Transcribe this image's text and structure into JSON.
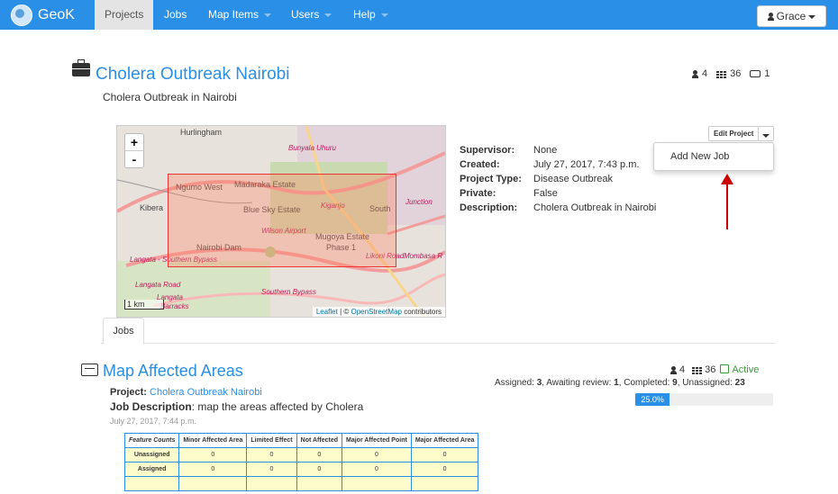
{
  "nav": {
    "brand": "GeoK",
    "items": [
      {
        "label": "Projects",
        "active": true,
        "dropdown": false
      },
      {
        "label": "Jobs",
        "active": false,
        "dropdown": false
      },
      {
        "label": "Map Items",
        "active": false,
        "dropdown": true
      },
      {
        "label": "Users",
        "active": false,
        "dropdown": true
      },
      {
        "label": "Help",
        "active": false,
        "dropdown": true
      }
    ],
    "user": "Grace"
  },
  "project": {
    "title": "Cholera Outbreak Nairobi",
    "subtitle": "Cholera Outbreak in Nairobi",
    "stats": {
      "users": "4",
      "items": "36",
      "jobs": "1"
    },
    "details": [
      {
        "key": "Supervisor:",
        "value": "None"
      },
      {
        "key": "Created:",
        "value": "July 27, 2017, 7:43 p.m."
      },
      {
        "key": "Project Type:",
        "value": "Disease Outbreak"
      },
      {
        "key": "Private:",
        "value": "False"
      },
      {
        "key": "Description:",
        "value": "Cholera Outbreak in Nairobi"
      }
    ],
    "edit_button": "Edit Project",
    "dropdown_item": "Add New Job"
  },
  "map": {
    "zoom_in": "+",
    "zoom_out": "-",
    "scale": "1 km",
    "attribution_leaflet": "Leaflet",
    "attribution_sep": " | © ",
    "attribution_osm": "OpenStreetMap",
    "attribution_tail": " contributors",
    "labels": [
      "Hurlingham",
      "Ngumo West",
      "Madaraka Estate",
      "Kibera",
      "Blue Sky Estate",
      "Nairobi Dam",
      "Mugoya Estate",
      "Phase 1",
      "South"
    ],
    "road_labels": [
      "Bunyala Uhuru",
      "Kiganjo",
      "Junction",
      "Wilson Airport",
      "Langata - Southern Bypass",
      "Likoni Road",
      "Mombasa R",
      "Langata Road",
      "Langata",
      "Barracks",
      "Southern Bypass"
    ]
  },
  "tabs": [
    "Jobs"
  ],
  "job": {
    "title": "Map Affected Areas",
    "project_label": "Project:",
    "project_name": "Cholera Outbreak Nairobi",
    "desc_label": "Job Description",
    "desc_value": ": map the areas affected by Cholera",
    "date": "July 27, 2017, 7:44 p.m.",
    "stats": {
      "users": "4",
      "items": "36",
      "status": "Active"
    },
    "assign": {
      "assigned_label": "Assigned: ",
      "assigned": "3",
      "awaiting_label": ", Awaiting review: ",
      "awaiting": "1",
      "completed_label": ", Completed: ",
      "completed": "9",
      "unassigned_label": ", Unassigned: ",
      "unassigned": "23"
    },
    "progress": 25.0,
    "progress_label": "25.0%"
  },
  "feature_table": {
    "headers": [
      "Feature Counts",
      "Minor Affected Area",
      "Limited Effect",
      "Not Affected",
      "Major Affected Point",
      "Major Affected Area"
    ],
    "rows": [
      {
        "label": "Unassigned",
        "values": [
          "0",
          "0",
          "0",
          "0",
          "0"
        ]
      },
      {
        "label": "Assigned",
        "values": [
          "0",
          "0",
          "0",
          "0",
          "0"
        ]
      }
    ]
  }
}
